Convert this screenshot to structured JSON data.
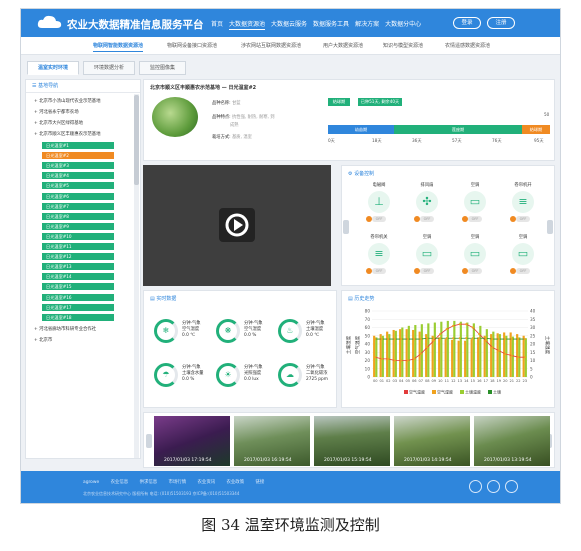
{
  "app": {
    "title": "农业大数据精准信息服务平台"
  },
  "nav": {
    "items": [
      "首页",
      "大数据资源池",
      "大数据云服务",
      "数据服务工具",
      "解决方案",
      "大数据分中心"
    ],
    "login": "登录",
    "register": "注册"
  },
  "subnav": [
    "物联网智能数据资源池",
    "物联网设备接口资源池",
    "涉农网站互联网数据资源池",
    "用户大数据资源池",
    "知识与模型资源池",
    "农情遥感数据资源池"
  ],
  "tabs": [
    "温室实时环境",
    "环境数据分析",
    "监控图像集"
  ],
  "sidebar": {
    "title": "基地导航",
    "bases": [
      "北京市小汤山现代农业示范基地",
      "河北省永宁都市农场",
      "北京市大兴区绿得基地",
      "北京市顺义区丰顺惠农示范基地"
    ],
    "greenhouses": [
      "日光温室#1",
      "日光温室#2",
      "日光温室#3",
      "日光温室#4",
      "日光温室#5",
      "日光温室#6",
      "日光温室#7",
      "日光温室#8",
      "日光温室#9",
      "日光温室#10",
      "日光温室#11",
      "日光温室#12",
      "日光温室#13",
      "日光温室#14",
      "日光温室#15",
      "日光温室#16",
      "日光温室#17",
      "日光温室#18"
    ],
    "bases_after": [
      "河北省廊坊市科研专业合作社",
      "北京市"
    ]
  },
  "info": {
    "title": "北京市顺义区丰顺惠农示范基地 — 日光温室#2",
    "crop_name_label": "品种名称:",
    "crop_name": "甘蓝",
    "crop_feature_label": "品种特点:",
    "crop_feature": "抗性强, 耐热, 耐寒, 到",
    "crop_feature_cont": "成熟",
    "plant_area_label": "栽培方式:",
    "plant_area": "基质, 温室",
    "stage_badge": "结球期",
    "days_badge": "已种51天, 剩余40天",
    "stages": [
      "幼苗期",
      "莲座期",
      "结球期"
    ],
    "ticks": [
      "0天",
      "18天",
      "36天",
      "57天",
      "76天",
      "95天"
    ],
    "gauge_top": "50"
  },
  "devices": {
    "title": "设备控制",
    "items": [
      {
        "label": "电磁阀",
        "icon": "valve-icon",
        "state": "OFF"
      },
      {
        "label": "排风扇",
        "icon": "fan-icon",
        "state": "OFF"
      },
      {
        "label": "空调",
        "icon": "ac-icon",
        "state": "OFF"
      },
      {
        "label": "卷帘机开",
        "icon": "shutter-icon",
        "state": "OFF"
      },
      {
        "label": "卷帘机关",
        "icon": "shutter-icon",
        "state": "OFF"
      },
      {
        "label": "空调",
        "icon": "ac-icon",
        "state": "OFF"
      },
      {
        "label": "空调",
        "icon": "ac-icon",
        "state": "OFF"
      },
      {
        "label": "空调",
        "icon": "ac-icon",
        "state": "OFF"
      }
    ]
  },
  "realtime": {
    "title": "实时数据",
    "items": [
      {
        "line1": "分钟·气象",
        "line2": "空气温度",
        "value": "0.0 ℃"
      },
      {
        "line1": "分钟·气象",
        "line2": "空气湿度",
        "value": "0.0 %"
      },
      {
        "line1": "分钟·气象",
        "line2": "土壤温度",
        "value": "0.0 ℃"
      },
      {
        "line1": "分钟·气象",
        "line2": "土壤含水量",
        "value": "0.0 %"
      },
      {
        "line1": "分钟·气象",
        "line2": "光照强度",
        "value": "0.0 lux"
      },
      {
        "line1": "分钟·气象",
        "line2": "二氧化碳浓",
        "value": "2725 ppm"
      }
    ]
  },
  "chart_data": {
    "type": "bar",
    "title": "历史走势",
    "x": [
      "00",
      "01",
      "02",
      "03",
      "04",
      "05",
      "06",
      "07",
      "08",
      "09",
      "10",
      "11",
      "12",
      "13",
      "14",
      "15",
      "16",
      "17",
      "18",
      "19",
      "20",
      "21",
      "22",
      "23"
    ],
    "series": [
      {
        "name": "空气温度",
        "kind": "line",
        "color": "#e23b3b",
        "axis": "right",
        "values": [
          12,
          11,
          11,
          10,
          10,
          10,
          11,
          14,
          18,
          22,
          26,
          29,
          31,
          32,
          32,
          30,
          26,
          22,
          18,
          16,
          14,
          13,
          12,
          12
        ]
      },
      {
        "name": "空气湿度",
        "kind": "bar",
        "color": "#f0a21e",
        "axis": "left",
        "values": [
          50,
          52,
          55,
          57,
          58,
          58,
          57,
          55,
          52,
          50,
          48,
          46,
          45,
          44,
          44,
          46,
          48,
          50,
          52,
          53,
          54,
          54,
          52,
          50
        ]
      },
      {
        "name": "土壤温度",
        "kind": "bar",
        "color": "#9acd32",
        "axis": "left",
        "values": [
          48,
          50,
          52,
          56,
          60,
          62,
          63,
          64,
          65,
          66,
          67,
          68,
          68,
          67,
          66,
          65,
          62,
          58,
          55,
          52,
          50,
          49,
          48,
          47
        ]
      },
      {
        "name": "土壤",
        "kind": "line",
        "color": "#2a8f2a",
        "axis": "left",
        "values": [
          46,
          46,
          46,
          46,
          46,
          46,
          46,
          46,
          47,
          47,
          47,
          47,
          47,
          47,
          47,
          47,
          47,
          47,
          46,
          46,
          46,
          46,
          46,
          46
        ]
      }
    ],
    "yleft": {
      "label": "土壤湿度",
      "ticks": [
        "0",
        "10",
        "20",
        "30",
        "40",
        "50",
        "60",
        "70",
        "80"
      ],
      "ylim": [
        0,
        80
      ]
    },
    "yright": {
      "label": "土壤温度",
      "ticks": [
        "0",
        "5",
        "10",
        "15",
        "20",
        "25",
        "30",
        "35",
        "40"
      ],
      "ylim": [
        0,
        40
      ]
    },
    "ylabel2": "空气温度",
    "grid": true,
    "legend_position": "bottom"
  },
  "photos": [
    "2017/01/03 17:19:54",
    "2017/01/03 16:19:54",
    "2017/01/03 15:19:54",
    "2017/01/03 14:19:54",
    "2017/01/03 13:19:54"
  ],
  "footer": {
    "links": [
      "agrowe",
      "农业信息",
      "供求信息",
      "市场行情",
      "农业资讯",
      "农业政策",
      "链接"
    ],
    "copyright": "北京农业信息技术研究中心 版权所有 电话: (010)51503193 京ICP备:(010)51503344"
  },
  "caption": "图 34   温室环境监测及控制",
  "colors": {
    "brand": "#2f86dc",
    "green": "#21b07a",
    "orange": "#f08a22"
  }
}
